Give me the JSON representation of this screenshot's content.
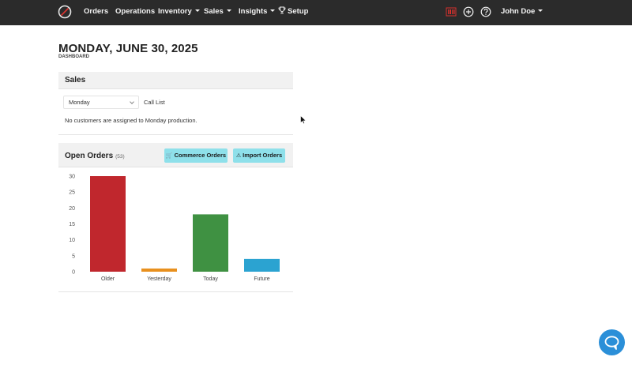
{
  "nav": {
    "items": [
      {
        "label": "Orders",
        "has_caret": false
      },
      {
        "label": "Operations",
        "has_caret": false
      },
      {
        "label": "Inventory",
        "has_caret": true
      },
      {
        "label": "Sales",
        "has_caret": true
      },
      {
        "label": "Insights",
        "has_caret": true
      }
    ],
    "setup_label": "Setup",
    "user_name": "John Doe",
    "icons": [
      "logo-icon",
      "barcode-icon",
      "plus-circle-icon",
      "help-circle-icon",
      "trophy-icon"
    ],
    "bar_color": "#2b2b2b"
  },
  "page": {
    "title": "MONDAY, JUNE 30, 2025",
    "subtitle": "DASHBOARD"
  },
  "sales": {
    "title": "Sales",
    "day_select": "Monday",
    "call_list_label": "Call List",
    "empty_message": "No customers are assigned to Monday production."
  },
  "open_orders": {
    "title": "Open Orders",
    "count": "(53)",
    "commerce_button": "Commerce Orders",
    "import_button": "Import Orders",
    "button_color": "#8ee0ea"
  },
  "chart_data": {
    "type": "bar",
    "categories": [
      "Older",
      "Yesterday",
      "Today",
      "Future"
    ],
    "values": [
      30,
      1,
      18,
      4
    ],
    "colors": [
      "#c0272d",
      "#e8901e",
      "#3f9142",
      "#2ba3d1"
    ],
    "yticks": [
      0,
      5,
      10,
      15,
      20,
      25,
      30
    ],
    "ylim": [
      0,
      30
    ],
    "grid": false,
    "legend": "none"
  },
  "support": {
    "icon": "chat-bubble-icon",
    "color": "#2b8fd8"
  }
}
